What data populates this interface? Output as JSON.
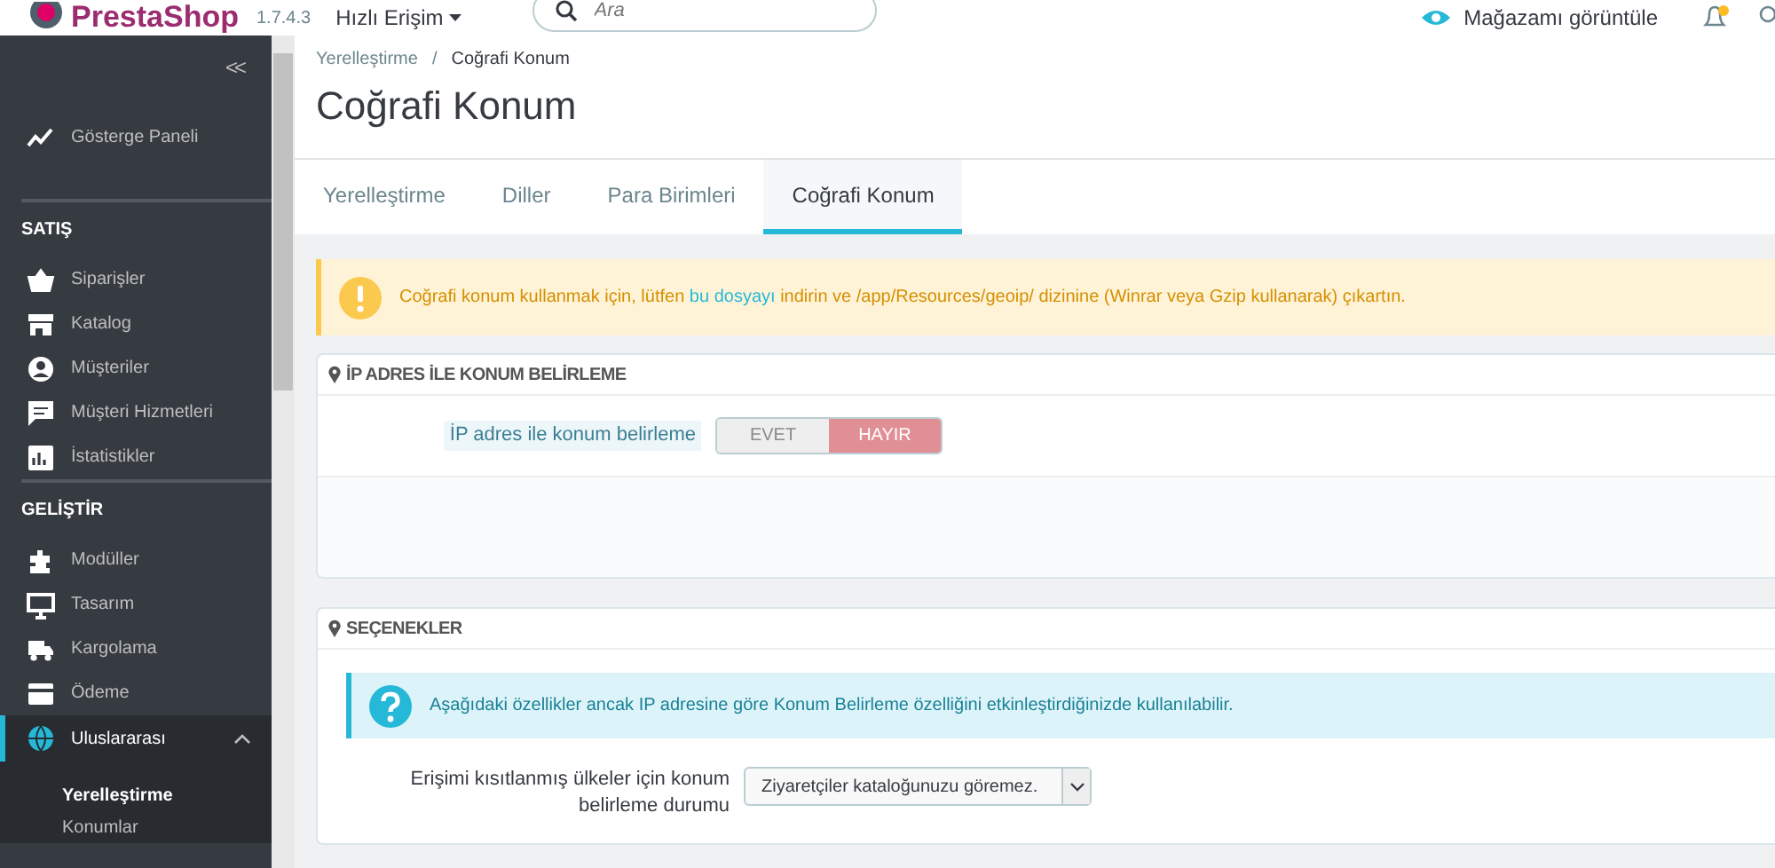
{
  "topbar": {
    "logo": "PrestaShop",
    "version": "1.7.4.3",
    "quick_access": "Hızlı Erişim",
    "search": {
      "placeholder": "Ara"
    },
    "view_store": "Mağazamı görüntüle"
  },
  "sidebar": {
    "collapse": "<<",
    "sections": [
      {
        "items": [
          {
            "label": "Gösterge Paneli",
            "selected": false,
            "expanded": false
          }
        ]
      },
      {
        "heading": "SATIŞ",
        "items": [
          {
            "label": "Siparişler",
            "selected": false,
            "expanded": false
          },
          {
            "label": "Katalog",
            "selected": false,
            "expanded": false
          },
          {
            "label": "Müşteriler",
            "selected": false,
            "expanded": false
          },
          {
            "label": "Müşteri Hizmetleri",
            "selected": false,
            "expanded": false
          },
          {
            "label": "İstatistikler",
            "selected": false,
            "expanded": false
          }
        ]
      },
      {
        "heading": "GELİŞTİR",
        "items": [
          {
            "label": "Modüller",
            "selected": false,
            "expanded": false
          },
          {
            "label": "Tasarım",
            "selected": false,
            "expanded": false
          },
          {
            "label": "Kargolama",
            "selected": false,
            "expanded": false
          },
          {
            "label": "Ödeme",
            "selected": false,
            "expanded": false
          },
          {
            "label": "Uluslararası",
            "selected": true,
            "expanded": true,
            "children": [
              {
                "label": "Yerelleştirme",
                "selected": true
              },
              {
                "label": "Konumlar",
                "selected": false
              }
            ]
          }
        ]
      }
    ]
  },
  "breadcrumb": [
    "Yerelleştirme",
    "Coğrafi Konum"
  ],
  "breadcrumb_separator": "/",
  "page_title": "Coğrafi Konum",
  "tabs": [
    {
      "label": "Yerelleştirme",
      "selected": false
    },
    {
      "label": "Diller",
      "selected": false
    },
    {
      "label": "Para Birimleri",
      "selected": false
    },
    {
      "label": "Coğrafi Konum",
      "selected": true
    }
  ],
  "warning": {
    "before": "Coğrafi konum kullanmak için, lütfen ",
    "link": "bu dosyayı",
    "after": " indirin ve /app/Resources/geoip/ dizinine (Winrar veya Gzip kullanarak) çıkartın."
  },
  "panels": [
    {
      "title": "İP ADRES İLE KONUM BELİRLEME",
      "fields": [
        {
          "kind": "switch",
          "label": "İP adres ile konum belirleme",
          "options": [
            {
              "label": "EVET",
              "selected": false
            },
            {
              "label": "HAYIR",
              "selected": true
            }
          ]
        }
      ]
    },
    {
      "title": "SEÇENEKLER",
      "info": "Aşağıdaki özellikler ancak IP adresine göre Konum Belirleme özelliğini etkinleştirdiğinizde kullanılabilir.",
      "fields": [
        {
          "kind": "select",
          "label": "Erişimi kısıtlanmış ülkeler için konum belirleme durumu",
          "value": "Ziyaretçiler kataloğunuzu göremez."
        }
      ]
    }
  ]
}
